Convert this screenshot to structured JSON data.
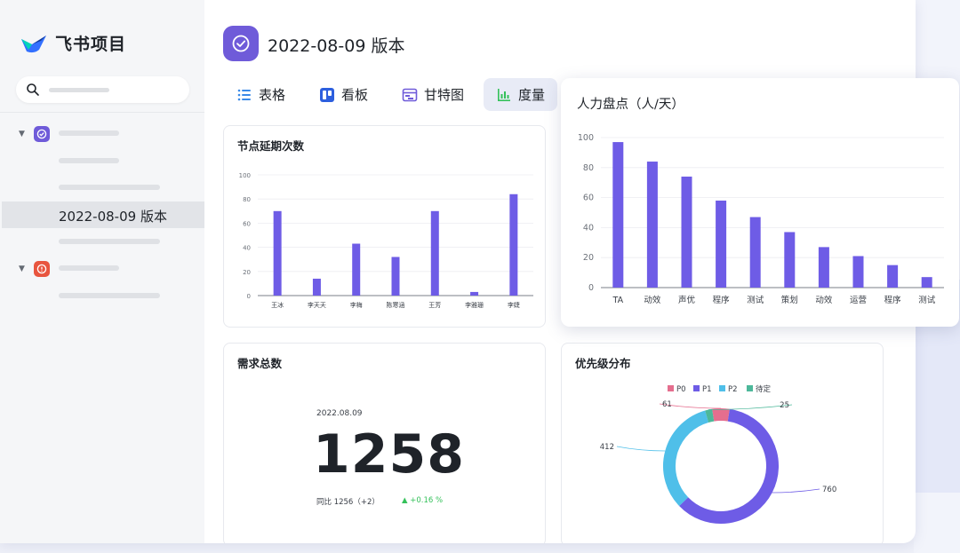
{
  "app": {
    "name": "飞书项目"
  },
  "sidebar": {
    "active_item": "2022-08-09 版本"
  },
  "header": {
    "title": "2022-08-09 版本"
  },
  "tabs": [
    {
      "label": "表格",
      "icon": "list-icon"
    },
    {
      "label": "看板",
      "icon": "kanban-icon"
    },
    {
      "label": "甘特图",
      "icon": "gantt-icon"
    },
    {
      "label": "度量",
      "icon": "bar-chart-icon",
      "active": true
    }
  ],
  "colors": {
    "accent": "#6f5bd9",
    "bar": "#6e5ce6",
    "p0": "#e56e8e",
    "p1": "#6e5ce6",
    "p2": "#4fbfe9",
    "pending": "#4db89a",
    "up": "#34c15a",
    "red_badge": "#e8553f"
  },
  "cards": {
    "delays": {
      "title": "节点延期次数"
    },
    "manpower": {
      "title": "人力盘点（人/天）"
    },
    "total": {
      "title": "需求总数",
      "date": "2022.08.09",
      "value": "1258",
      "yoy": "同比 1256（+2）",
      "delta": "▲ +0.16 %"
    },
    "priority": {
      "title": "优先级分布"
    }
  },
  "chart_data": [
    {
      "type": "bar",
      "title": "节点延期次数",
      "categories": [
        "王冰",
        "李天天",
        "李梅",
        "陈寒涵",
        "王芳",
        "李雅珊",
        "李婕"
      ],
      "values": [
        70,
        14,
        43,
        32,
        70,
        3,
        84
      ],
      "ylim": [
        0,
        100
      ],
      "yticks": [
        0,
        20,
        40,
        60,
        80,
        100
      ],
      "grid": true
    },
    {
      "type": "bar",
      "title": "人力盘点（人/天）",
      "categories": [
        "TA",
        "动效",
        "声优",
        "程序",
        "测试",
        "策划",
        "动效",
        "运营",
        "程序",
        "测试"
      ],
      "values": [
        97,
        84,
        74,
        58,
        47,
        37,
        27,
        21,
        15,
        7
      ],
      "ylim": [
        0,
        100
      ],
      "yticks": [
        0,
        20,
        40,
        60,
        80,
        100
      ],
      "grid": true
    },
    {
      "type": "pie",
      "title": "优先级分布",
      "legend": [
        "P0",
        "P1",
        "P2",
        "待定"
      ],
      "legend_position": "top",
      "slices": [
        {
          "label": "P0",
          "value": 61
        },
        {
          "label": "P1",
          "value": 760
        },
        {
          "label": "P2",
          "value": 412
        },
        {
          "label": "待定",
          "value": 25
        }
      ]
    }
  ]
}
